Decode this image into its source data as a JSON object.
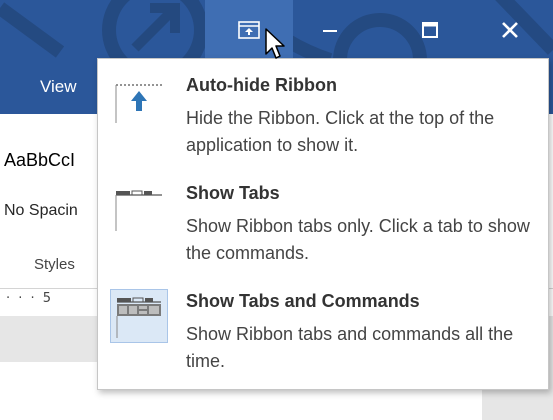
{
  "titlebar": {
    "ribbon_display_options_icon": "ribbon-display-options-icon",
    "minimize_icon": "minimize-icon",
    "maximize_icon": "maximize-icon",
    "close_icon": "close-icon",
    "minimize_glyph": "–",
    "maximize_glyph": "☐",
    "close_glyph": "✕"
  },
  "ribbon": {
    "tabs": [
      {
        "label": "View"
      }
    ],
    "styles": {
      "sample_text": "AaBbCcI",
      "style_name": "No Spacin",
      "group_label": "Styles"
    },
    "ruler_text": "· · · 5"
  },
  "ribbon_display_menu": {
    "items": [
      {
        "title": "Auto-hide Ribbon",
        "description": "Hide the Ribbon. Click at the top of the application to show it.",
        "icon": "auto-hide-ribbon-icon",
        "selected": false
      },
      {
        "title": "Show Tabs",
        "description": "Show Ribbon tabs only. Click a tab to show the commands.",
        "icon": "show-tabs-icon",
        "selected": false
      },
      {
        "title": "Show Tabs and Commands",
        "description": "Show Ribbon tabs and commands all the time.",
        "icon": "show-tabs-and-commands-icon",
        "selected": true
      }
    ]
  },
  "colors": {
    "accent": "#2b579a",
    "highlight": "#3f6eb3",
    "selected_bg": "#dbe8f6",
    "icon_blue": "#2e75b6"
  }
}
